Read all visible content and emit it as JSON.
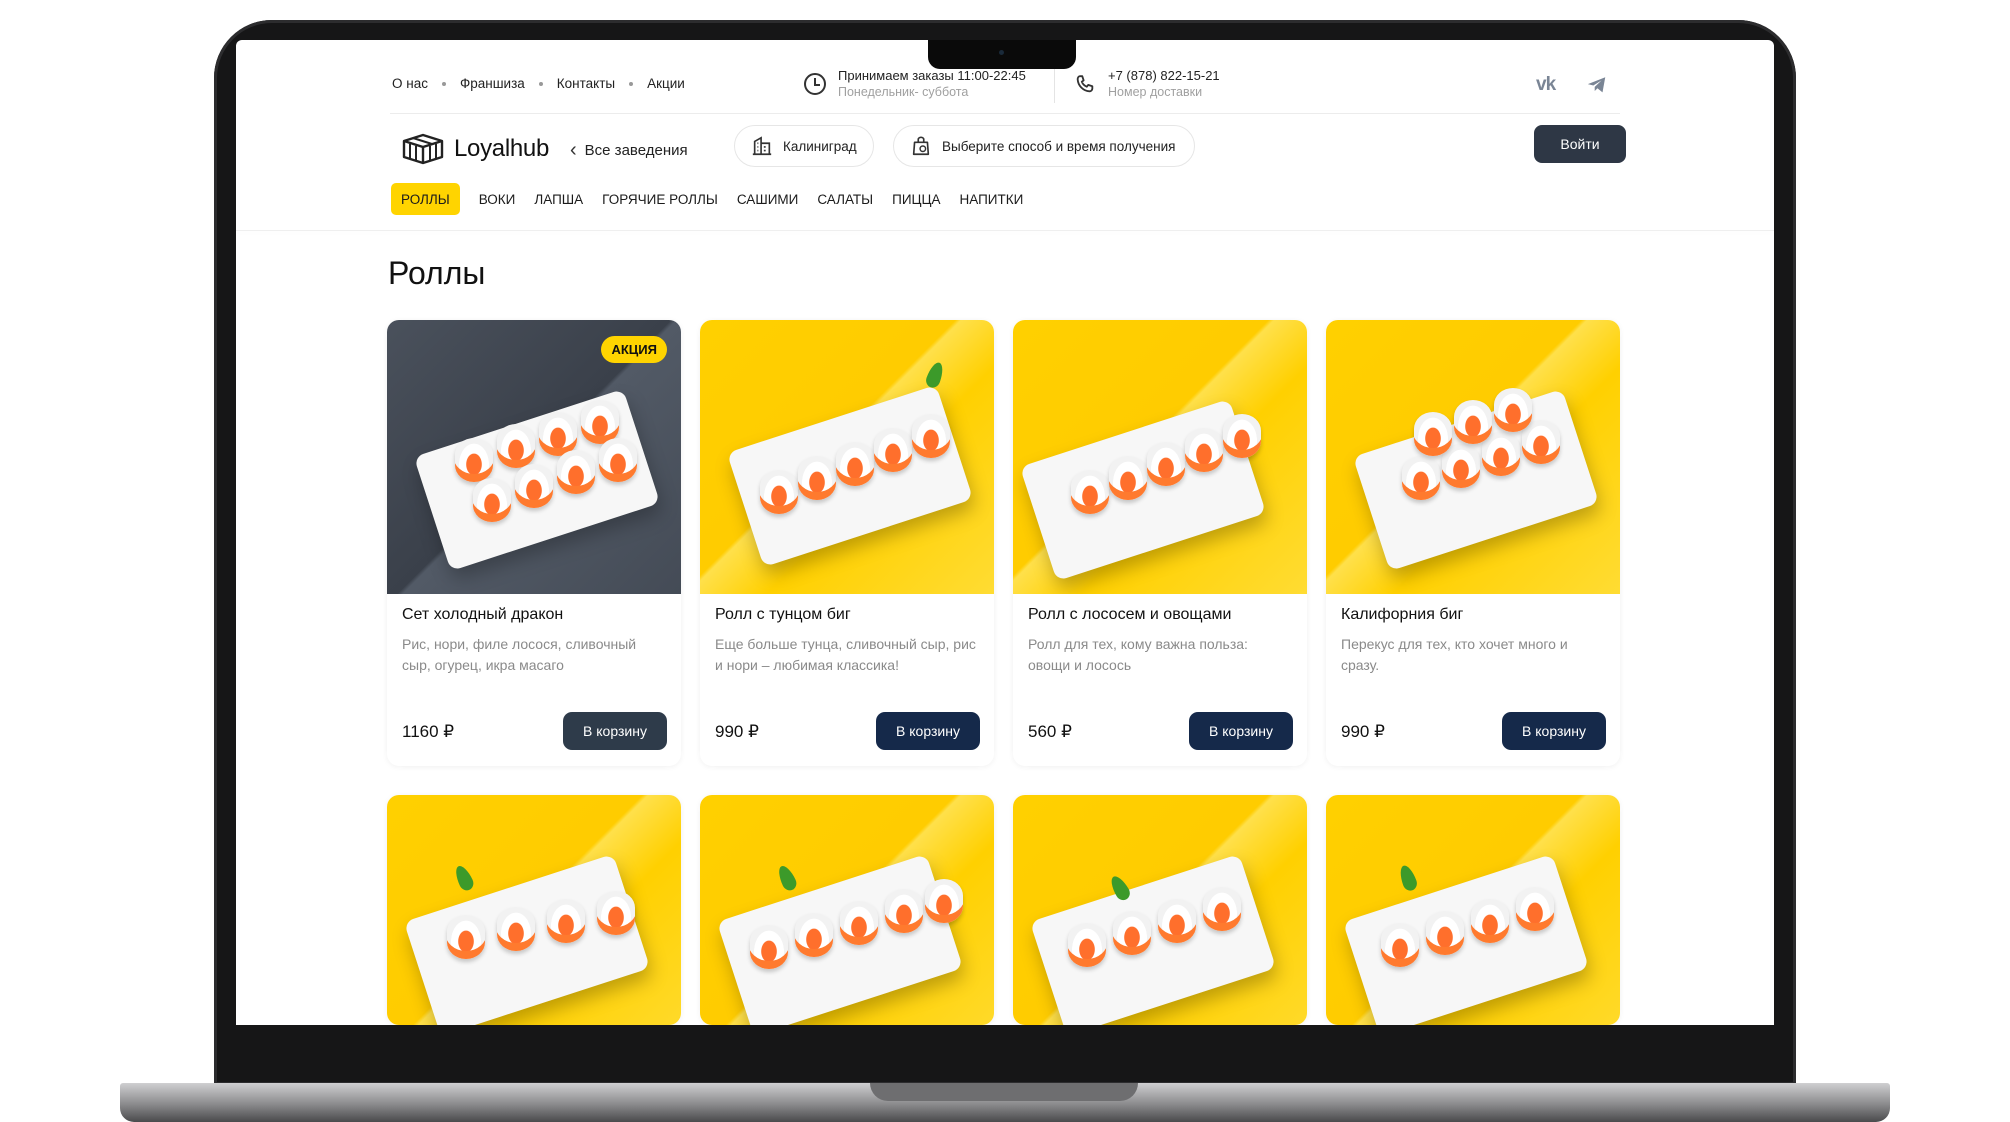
{
  "top_links": [
    "О нас",
    "Франшиза",
    "Контакты",
    "Акции"
  ],
  "hours": {
    "title": "Принимаем заказы 11:00-22:45",
    "subtitle": "Понедельник- суббота"
  },
  "phone": {
    "number": "+7 (878) 822-15-21",
    "subtitle": "Номер доставки"
  },
  "social": {
    "vk_icon": "vk-icon",
    "telegram_icon": "telegram-icon"
  },
  "brand": {
    "name": "Loyalhub"
  },
  "back_label": "Все заведения",
  "city_pill": "Калиниград",
  "delivery_pill": "Выберите способ и время получения",
  "login_label": "Войти",
  "categories": [
    "РОЛЛЫ",
    "ВОКИ",
    "ЛАПША",
    "ГОРЯЧИЕ РОЛЛЫ",
    "САШИМИ",
    "САЛАТЫ",
    "ПИЦЦА",
    "НАПИТКИ"
  ],
  "active_category": "РОЛЛЫ",
  "page_title": "Роллы",
  "colors": {
    "accent": "#ffd400",
    "button_dark": "#15294a",
    "login_bg": "#2e3745"
  },
  "products": [
    {
      "title": "Сет холодный дракон",
      "desc": "Рис, нори, филе лосося, сливочный сыр, огурец, икра масаго",
      "price": "1160 ₽",
      "button": "В корзину",
      "badge": "АКЦИЯ"
    },
    {
      "title": "Ролл с тунцом биг",
      "desc": "Еще больше тунца, сливочный сыр, рис и нори – любимая классика!",
      "price": "990 ₽",
      "button": "В корзину"
    },
    {
      "title": "Ролл с лососем и овощами",
      "desc": "Ролл для тех, кому важна польза: овощи  и лосось",
      "price": "560 ₽",
      "button": "В корзину"
    },
    {
      "title": "Калифорния биг",
      "desc": "Перекус для тех, кто хочет много и сразу.",
      "price": "990 ₽",
      "button": "В корзину"
    }
  ]
}
